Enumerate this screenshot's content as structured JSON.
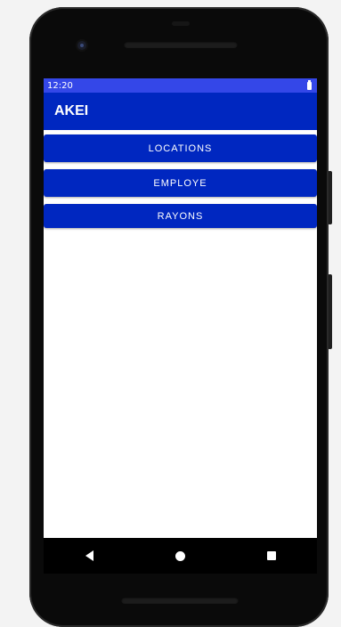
{
  "status_bar": {
    "time": "12:20",
    "battery_icon": "battery-icon"
  },
  "app_bar": {
    "title": "AKEI"
  },
  "buttons": [
    {
      "label": "LOCATIONS"
    },
    {
      "label": "EMPLOYE"
    },
    {
      "label": "RAYONS"
    }
  ],
  "nav_bar": {
    "back_icon": "back-triangle-icon",
    "home_icon": "home-circle-icon",
    "recent_icon": "recent-square-icon"
  },
  "colors": {
    "status_bar": "#3447e8",
    "primary": "#0027c0",
    "screen_bg": "#ffffff",
    "nav_bar": "#000000"
  }
}
